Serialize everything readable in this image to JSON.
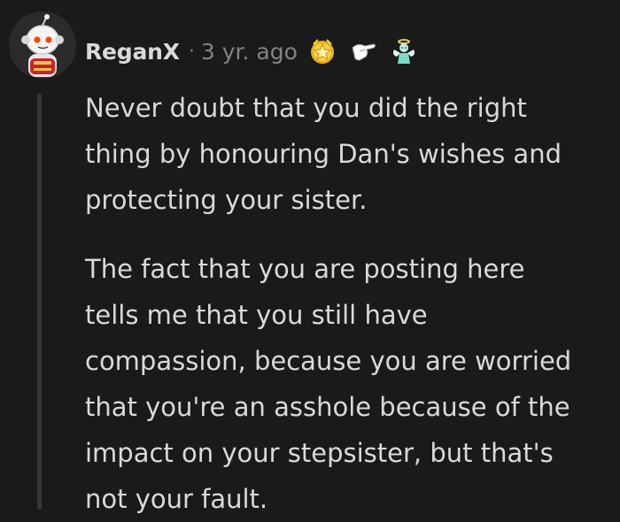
{
  "comment": {
    "username": "ReganX",
    "separator": "·",
    "timestamp": "3 yr. ago",
    "awards": [
      "star-award-icon",
      "glove-pointing-award-icon",
      "angel-award-icon"
    ],
    "body": {
      "paragraph_1": {
        "line_1": "Never doubt that you did the right",
        "line_2": "thing by honouring Dan's wishes and",
        "line_3": "protecting your sister."
      },
      "paragraph_2": {
        "line_1": "The fact that you are posting here",
        "line_2": "tells me that you still have",
        "line_3": "compassion, because you are worried",
        "line_4": "that you're an asshole because of the",
        "line_5": "impact on your stepsister, but that's",
        "line_6": "not your fault."
      }
    }
  },
  "colors": {
    "background": "#1a1a1b",
    "text": "#d7dadc",
    "meta": "#818384",
    "thread_line": "#343536"
  }
}
